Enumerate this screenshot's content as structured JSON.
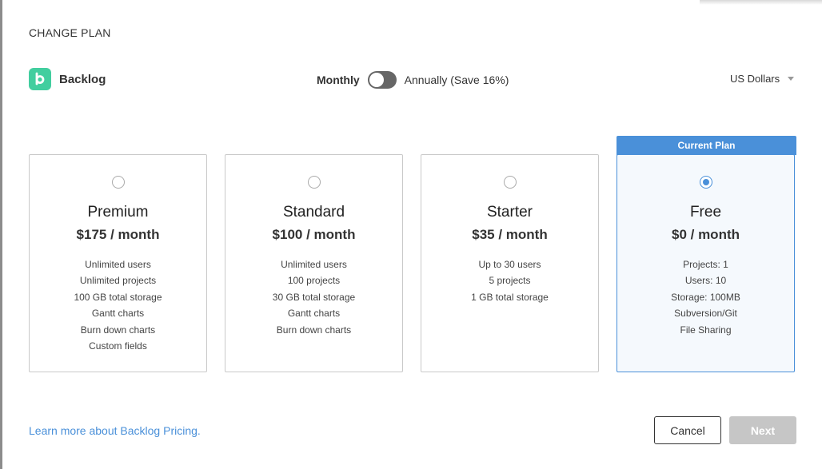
{
  "dialog": {
    "title": "CHANGE PLAN"
  },
  "brand": {
    "name": "Backlog",
    "logo_letter": "b",
    "logo_color": "#42ce9f"
  },
  "billing": {
    "monthly_label": "Monthly",
    "annually_label": "Annually (Save 16%)",
    "annual_selected": false
  },
  "currency": {
    "selected": "US Dollars"
  },
  "current_plan_label": "Current Plan",
  "plans": [
    {
      "name": "Premium",
      "price": "$175 / month",
      "selected": false,
      "features": [
        "Unlimited users",
        "Unlimited projects",
        "100 GB total storage",
        "Gantt charts",
        "Burn down charts",
        "Custom fields"
      ]
    },
    {
      "name": "Standard",
      "price": "$100 / month",
      "selected": false,
      "features": [
        "Unlimited users",
        "100 projects",
        "30 GB total storage",
        "Gantt charts",
        "Burn down charts"
      ]
    },
    {
      "name": "Starter",
      "price": "$35 / month",
      "selected": false,
      "features": [
        "Up to 30 users",
        "5 projects",
        "1 GB total storage"
      ]
    },
    {
      "name": "Free",
      "price": "$0 / month",
      "selected": true,
      "current": true,
      "features": [
        "Projects: 1",
        "Users: 10",
        "Storage: 100MB",
        "Subversion/Git",
        "File Sharing"
      ]
    }
  ],
  "footer": {
    "learn_more": "Learn more about Backlog Pricing.",
    "cancel_label": "Cancel",
    "next_label": "Next",
    "next_disabled": true
  },
  "colors": {
    "accent": "#4a90d9",
    "toggle_off": "#666666",
    "disabled_button": "#c6c6c6"
  }
}
